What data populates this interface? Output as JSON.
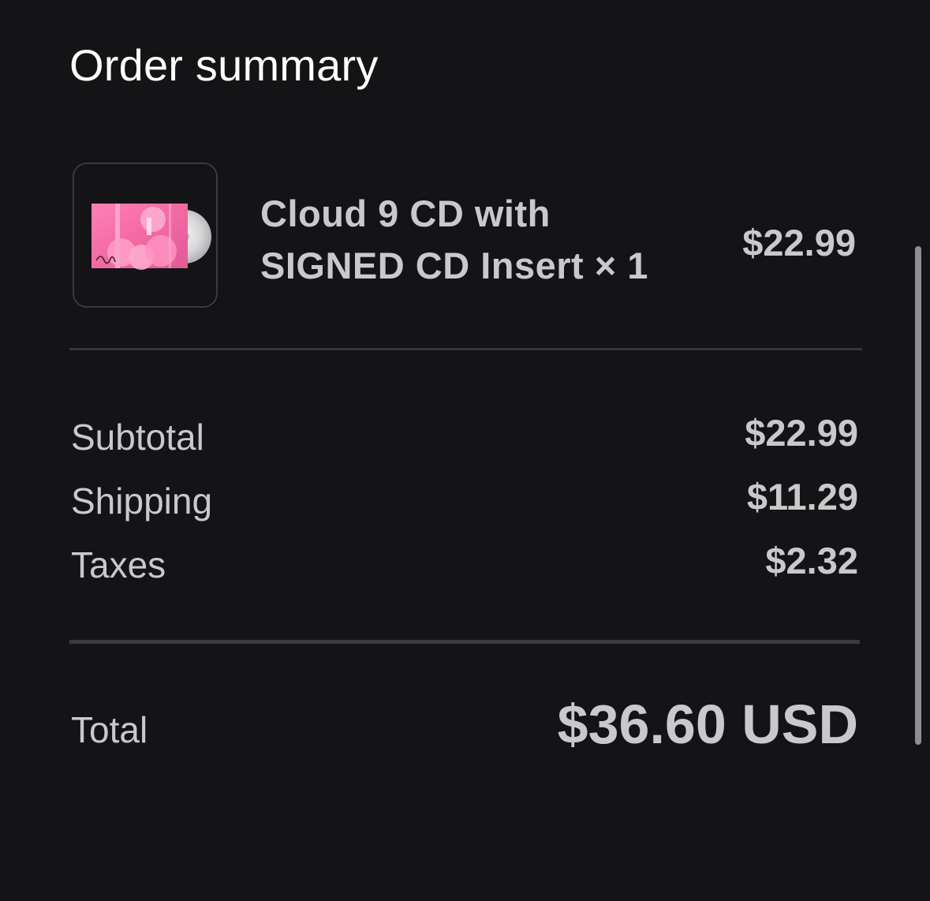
{
  "header": {
    "title": "Order summary"
  },
  "item": {
    "thumbnail_icon": "album-cd-thumbnail",
    "name": "Cloud 9 CD with SIGNED CD Insert × 1",
    "price": "$22.99"
  },
  "summary": {
    "rows": [
      {
        "label": "Subtotal",
        "value": "$22.99"
      },
      {
        "label": "Shipping",
        "value": "$11.29"
      },
      {
        "label": "Taxes",
        "value": "$2.32"
      }
    ]
  },
  "total": {
    "label": "Total",
    "value": "$36.60 USD"
  },
  "colors": {
    "background": "#141416",
    "title_text": "#ffffff",
    "body_text": "#c9c9cc",
    "divider": "#36363a",
    "album_pink": "#f06ba4"
  }
}
